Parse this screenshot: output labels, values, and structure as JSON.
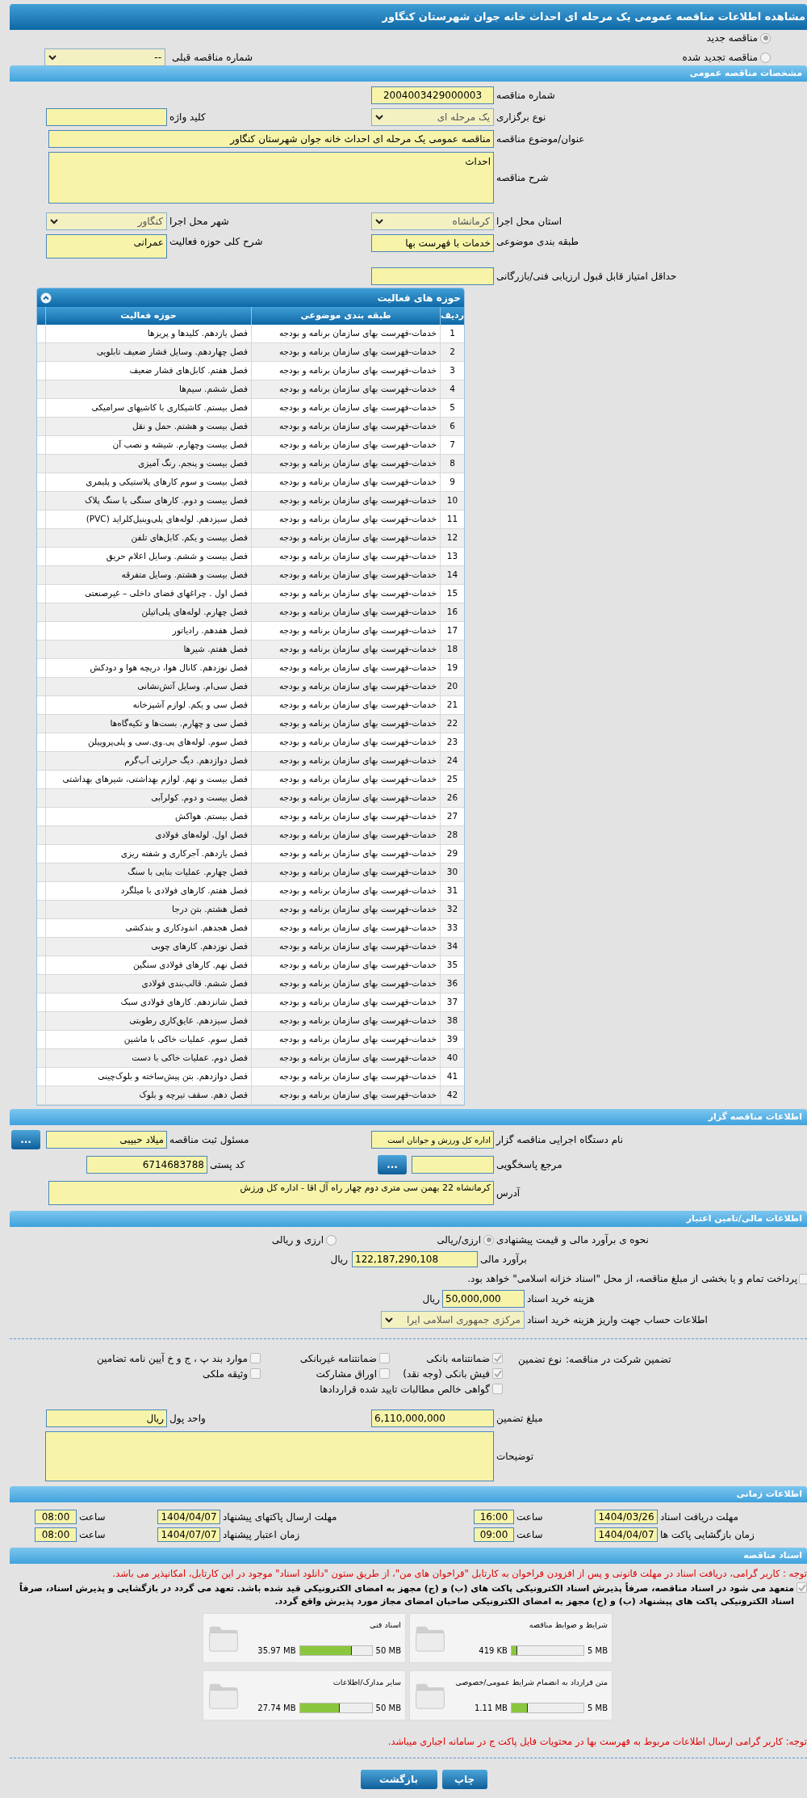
{
  "page_title": "مشاهده اطلاعات مناقصه عمومی یک مرحله ای احداث خانه جوان شهرستان کنگاور",
  "tender_kinds": [
    {
      "label": "مناقصه جدید",
      "selected": true
    },
    {
      "label": "مناقصه تجدید شده",
      "selected": false
    }
  ],
  "previous_tender": {
    "label": "شماره مناقصه قبلی",
    "value": "--"
  },
  "general": {
    "title": "مشخصات مناقصه عمومی",
    "tender_number": {
      "label": "شماره مناقصه",
      "value": "2004003429000003"
    },
    "holding_type": {
      "label": "نوع برگزاری",
      "value": "یک مرحله ای"
    },
    "keyword": {
      "label": "کلید واژه"
    },
    "subject": {
      "label": "عنوان/موضوع مناقصه",
      "value": "مناقصه عمومی یک مرحله ای احداث خانه جوان شهرستان کنگاور"
    },
    "description": {
      "label": "شرح مناقصه",
      "value": "احداث"
    },
    "province": {
      "label": "استان محل اجرا",
      "value": "کرمانشاه"
    },
    "city": {
      "label": "شهر محل اجرا",
      "value": "کنگاور"
    },
    "category": {
      "label": "طبقه بندی موضوعی",
      "value": "خدمات با فهرست بها"
    },
    "activity_summary": {
      "label": "شرح کلی حوزه فعالیت",
      "value": "عمرانی"
    },
    "min_score": {
      "label": "حداقل امتیاز قابل قبول ارزیابی فنی/بازرگانی"
    }
  },
  "activity_table": {
    "title": "حوزه های فعالیت",
    "columns": [
      "ردیف",
      "طبقه بندی موضوعی",
      "حوزه فعالیت"
    ],
    "rows": [
      [
        "1",
        "خدمات-فهرست بهای سازمان برنامه و بودجه",
        "فصل یازدهم. کلیدها و پریزها"
      ],
      [
        "2",
        "خدمات-فهرست بهای سازمان برنامه و بودجه",
        "فصل چهاردهم. وسایل فشار ضعیف تابلویی"
      ],
      [
        "3",
        "خدمات-فهرست بهای سازمان برنامه و بودجه",
        "فصل هفتم. کابل‌های فشار ضعیف"
      ],
      [
        "4",
        "خدمات-فهرست بهای سازمان برنامه و بودجه",
        "فصل ششم. سیم‌ها"
      ],
      [
        "5",
        "خدمات-فهرست بهای سازمان برنامه و بودجه",
        "فصل بیستم. کاشیکاری با کاشیهای سرامیکی"
      ],
      [
        "6",
        "خدمات-فهرست بهای سازمان برنامه و بودجه",
        "فصل بیست و هشتم. حمل و نقل"
      ],
      [
        "7",
        "خدمات-فهرست بهای سازمان برنامه و بودجه",
        "فصل بیست وچهارم. شیشه و نصب آن"
      ],
      [
        "8",
        "خدمات-فهرست بهای سازمان برنامه و بودجه",
        "فصل بیست و پنجم. رنگ آمیزی"
      ],
      [
        "9",
        "خدمات-فهرست بهای سازمان برنامه و بودجه",
        "فصل بیست و سوم کارهای پلاستیکی و پلیمری"
      ],
      [
        "10",
        "خدمات-فهرست بهای سازمان برنامه و بودجه",
        "فصل بیست و دوم. کارهای سنگی با سنگ پلاک"
      ],
      [
        "11",
        "خدمات-فهرست بهای سازمان برنامه و بودجه",
        "فصل سیزدهم. لوله‌های پلی‌وینیل‌کلراید (PVC)"
      ],
      [
        "12",
        "خدمات-فهرست بهای سازمان برنامه و بودجه",
        "فصل بیست و یکم. کابل‌های تلفن"
      ],
      [
        "13",
        "خدمات-فهرست بهای سازمان برنامه و بودجه",
        "فصل بیست و ششم. وسایل اعلام حریق"
      ],
      [
        "14",
        "خدمات-فهرست بهای سازمان برنامه و بودجه",
        "فصل بیست و هشتم. وسایل متفرقه"
      ],
      [
        "15",
        "خدمات-فهرست بهای سازمان برنامه و بودجه",
        "فصل اول . چراغهای فضای داخلی – غیرصنعتی"
      ],
      [
        "16",
        "خدمات-فهرست بهای سازمان برنامه و بودجه",
        "فصل چهارم. لوله‌های پلی‌اتیلن"
      ],
      [
        "17",
        "خدمات-فهرست بهای سازمان برنامه و بودجه",
        "فصل هفدهم. رادیاتور"
      ],
      [
        "18",
        "خدمات-فهرست بهای سازمان برنامه و بودجه",
        "فصل هفتم. شیرها"
      ],
      [
        "19",
        "خدمات-فهرست بهای سازمان برنامه و بودجه",
        "فصل نوزدهم. کانال هوا، دریچه هوا و دودکش"
      ],
      [
        "20",
        "خدمات-فهرست بهای سازمان برنامه و بودجه",
        "فصل سی‌ام. وسایل آتش‌نشانی"
      ],
      [
        "21",
        "خدمات-فهرست بهای سازمان برنامه و بودجه",
        "فصل سی و یکم. لوازم آشپزخانه"
      ],
      [
        "22",
        "خدمات-فهرست بهای سازمان برنامه و بودجه",
        "فصل سی و چهارم. بست‌ها و تکیه‌گاه‌ها"
      ],
      [
        "23",
        "خدمات-فهرست بهای سازمان برنامه و بودجه",
        "فصل سوم. لوله‌های پی.وی.سی و پلی‌پروپیلن"
      ],
      [
        "24",
        "خدمات-فهرست بهای سازمان برنامه و بودجه",
        "فصل دوازدهم. دیگ حرارتی آب‌گرم"
      ],
      [
        "25",
        "خدمات-فهرست بهای سازمان برنامه و بودجه",
        "فصل بیست و نهم. لوازم بهداشتی، شیرهای بهداشتی"
      ],
      [
        "26",
        "خدمات-فهرست بهای سازمان برنامه و بودجه",
        "فصل بیست و دوم. کولرآبی"
      ],
      [
        "27",
        "خدمات-فهرست بهای سازمان برنامه و بودجه",
        "فصل بیستم. هواکش"
      ],
      [
        "28",
        "خدمات-فهرست بهای سازمان برنامه و بودجه",
        "فصل اول. لوله‌های فولادی"
      ],
      [
        "29",
        "خدمات-فهرست بهای سازمان برنامه و بودجه",
        "فصل یازدهم. آجرکاری و شفته ریزی"
      ],
      [
        "30",
        "خدمات-فهرست بهای سازمان برنامه و بودجه",
        "فصل چهارم. عملیات بنایی با سنگ"
      ],
      [
        "31",
        "خدمات-فهرست بهای سازمان برنامه و بودجه",
        "فصل هفتم. کارهای فولادی با میلگرد"
      ],
      [
        "32",
        "خدمات-فهرست بهای سازمان برنامه و بودجه",
        "فصل هشتم. بتن درجا"
      ],
      [
        "33",
        "خدمات-فهرست بهای سازمان برنامه و بودجه",
        "فصل هجدهم. اندودکاری و بندکشی"
      ],
      [
        "34",
        "خدمات-فهرست بهای سازمان برنامه و بودجه",
        "فصل نوزدهم. کارهای چوبی"
      ],
      [
        "35",
        "خدمات-فهرست بهای سازمان برنامه و بودجه",
        "فصل نهم. کارهای فولادی سنگین"
      ],
      [
        "36",
        "خدمات-فهرست بهای سازمان برنامه و بودجه",
        "فصل ششم. قالب‌بندی فولادی"
      ],
      [
        "37",
        "خدمات-فهرست بهای سازمان برنامه و بودجه",
        "فصل شانزدهم. کارهای فولادی سبک"
      ],
      [
        "38",
        "خدمات-فهرست بهای سازمان برنامه و بودجه",
        "فصل سیزدهم. عایق‌کاری رطوبتی"
      ],
      [
        "39",
        "خدمات-فهرست بهای سازمان برنامه و بودجه",
        "فصل سوم. عملیات خاکی با ماشین"
      ],
      [
        "40",
        "خدمات-فهرست بهای سازمان برنامه و بودجه",
        "فصل دوم. عملیات خاکی با دست"
      ],
      [
        "41",
        "خدمات-فهرست بهای سازمان برنامه و بودجه",
        "فصل دوازدهم. بتن پیش‌ساخته و بلوک‌چینی"
      ],
      [
        "42",
        "خدمات-فهرست بهای سازمان برنامه و بودجه",
        "فصل دهم. سقف تیرچه و بلوک"
      ]
    ]
  },
  "organizer": {
    "title": "اطلاعات مناقصه گزار",
    "agency": {
      "label": "نام دستگاه اجرایی مناقصه گزار",
      "value": "اداره کل ورزش و جوانان است"
    },
    "registrar": {
      "label": "مسئول ثبت مناقصه",
      "value": "میلاد حبیبی",
      "button": "..."
    },
    "respondent": {
      "label": "مرجع پاسخگویی",
      "button": "..."
    },
    "postal_code": {
      "label": "کد پستی",
      "value": "6714683788"
    },
    "address": {
      "label": "آدرس",
      "value": "کرمانشاه 22 بهمن سی متری دوم چهار راه آل اقا - اداره کل ورزش"
    }
  },
  "financial": {
    "title": "اطلاعات مالی/تامین اعتبار",
    "method_label": "نحوه ی برآورد مالی و قیمت پیشنهادی",
    "methods": [
      {
        "label": "ارزی/ریالی",
        "selected": true
      },
      {
        "label": "ارزی و ریالی",
        "selected": false
      }
    ],
    "estimate": {
      "label": "برآورد مالی",
      "value": "122,187,290,108",
      "unit": "ریال"
    },
    "treasury": {
      "label": "پرداخت تمام و یا بخشی از مبلغ مناقصه، از محل \"اسناد خزانه اسلامی\" خواهد بود.",
      "checked": false
    },
    "doc_cost": {
      "label": "هزینه خرید اسناد",
      "value": "50,000,000",
      "unit": "ریال"
    },
    "account": {
      "label": "اطلاعات حساب جهت واریز هزینه خرید اسناد",
      "value": "مرکزی جمهوری اسلامی ایرا"
    }
  },
  "guarantee": {
    "label": "تضمین شرکت در مناقصه:",
    "type_label": "نوع تضمین",
    "options": [
      {
        "label": "ضمانتنامه بانکی",
        "checked": true
      },
      {
        "label": "ضمانتنامه غیربانکی",
        "checked": false
      },
      {
        "label": "موارد بند پ ، ج و خ آیین نامه تضامین",
        "checked": false
      },
      {
        "label": "فیش بانکی (وجه نقد)",
        "checked": true
      },
      {
        "label": "اوراق مشارکت",
        "checked": false
      },
      {
        "label": "وثیقه ملکی",
        "checked": false
      },
      {
        "label": "گواهی خالص مطالبات تایید شده قراردادها",
        "checked": false
      }
    ],
    "amount": {
      "label": "مبلغ تضمین",
      "value": "6,110,000,000"
    },
    "currency": {
      "label": "واحد پول",
      "value": "ریال"
    },
    "notes": {
      "label": "توضیحات"
    }
  },
  "timing": {
    "title": "اطلاعات زمانی",
    "rows": [
      {
        "label": "مهلت دریافت اسناد",
        "date": "1404/03/26",
        "time_label": "ساعت",
        "time": "16:00"
      },
      {
        "label": "مهلت ارسال پاکتهای پیشنهاد",
        "date": "1404/04/07",
        "time_label": "ساعت",
        "time": "08:00"
      },
      {
        "label": "زمان بازگشایی پاکت ها",
        "date": "1404/04/07",
        "time_label": "ساعت",
        "time": "09:00"
      },
      {
        "label": "زمان اعتبار پیشنهاد",
        "date": "1404/07/07",
        "time_label": "ساعت",
        "time": "08:00"
      }
    ]
  },
  "documents": {
    "title": "اسناد مناقصه",
    "notice": "توجه : کاربر گرامی، دریافت اسناد در مهلت قانونی و پس از افزودن فراخوان به کارتابل \"فراخوان های من\"، از طریق ستون \"دانلود اسناد\" موجود در این کارتابل، امکانپذیر می باشد.",
    "commitment": {
      "text": "متعهد می شود در اسناد مناقصه، صرفاً پذیرش اسناد الکترونیکی پاکت های (ب) و (ج) مجهز به امضای الکترونیکی قید شده باشد. تعهد می گردد در بازگشایی و پذیرش اسناد، صرفاً اسناد الکترونیکی پاکت های پیشنهاد (ب) و (ج) مجهز به امضای الکترونیکی صاحبان امضای مجاز مورد پذیرش واقع گردد.",
      "checked": true
    },
    "files": [
      {
        "name": "شرایط و ضوابط مناقصه",
        "max": "5 MB",
        "used": "419 KB",
        "level": 0.08
      },
      {
        "name": "اسناد فنی",
        "max": "50 MB",
        "used": "35.97 MB",
        "level": 0.72
      },
      {
        "name": "متن قرارداد به انضمام شرایط عمومی/خصوصی",
        "max": "5 MB",
        "used": "1.11 MB",
        "level": 0.22
      },
      {
        "name": "سایر مدارک/اطلاعات",
        "max": "50 MB",
        "used": "27.74 MB",
        "level": 0.55
      }
    ],
    "footer_note": "توجه: کاربر گرامی ارسال اطلاعات مربوط به فهرست بها در محتویات فایل پاکت ج در سامانه اجباری میباشد."
  },
  "buttons": [
    "چاپ",
    "بازگشت"
  ]
}
